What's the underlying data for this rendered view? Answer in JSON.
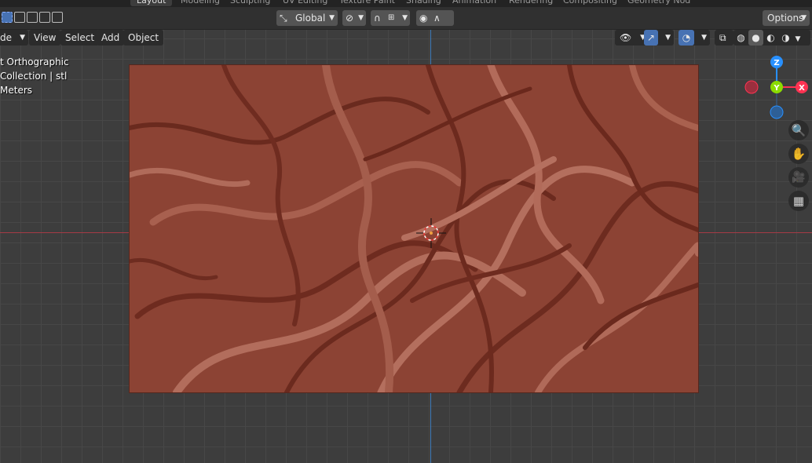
{
  "workspace_tabs": [
    "Layout",
    "Modeling",
    "Sculpting",
    "UV Editing",
    "Texture Paint",
    "Shading",
    "Animation",
    "Rendering",
    "Compositing",
    "Geometry Nod"
  ],
  "toolbar": {
    "transform_orientation": "Global",
    "options_label": "Options"
  },
  "viewport_menu": {
    "mode_partial": "de",
    "view": "View",
    "select": "Select",
    "add": "Add",
    "object": "Object"
  },
  "overlay": {
    "view_name": "t Orthographic",
    "collection": "Collection | stl",
    "units": "Meters"
  },
  "gizmo": {
    "z": "Z",
    "y": "Y",
    "x": "X"
  },
  "colors": {
    "x_axis": "#a53a45",
    "y_axis": "#3c7ab8",
    "gizmo_x": "#ff3352",
    "gizmo_y": "#8bdc00",
    "gizmo_z": "#2890ff",
    "texture_base": "#8c4334",
    "accent": "#4772b3"
  },
  "icons": {
    "select_box": "select-box-icon",
    "transform_pivot": "pivot-icon",
    "snap": "snap-magnet-icon",
    "proportional": "proportional-edit-icon",
    "visibility": "eye-icon",
    "gizmo_toggle": "gizmo-icon",
    "overlays": "overlays-icon",
    "xray": "xray-icon",
    "shading": [
      "wireframe-shading-icon",
      "solid-shading-icon",
      "material-shading-icon",
      "rendered-shading-icon"
    ],
    "zoom": "zoom-icon",
    "pan": "hand-pan-icon",
    "camera": "camera-icon",
    "grid": "grid-view-icon"
  }
}
